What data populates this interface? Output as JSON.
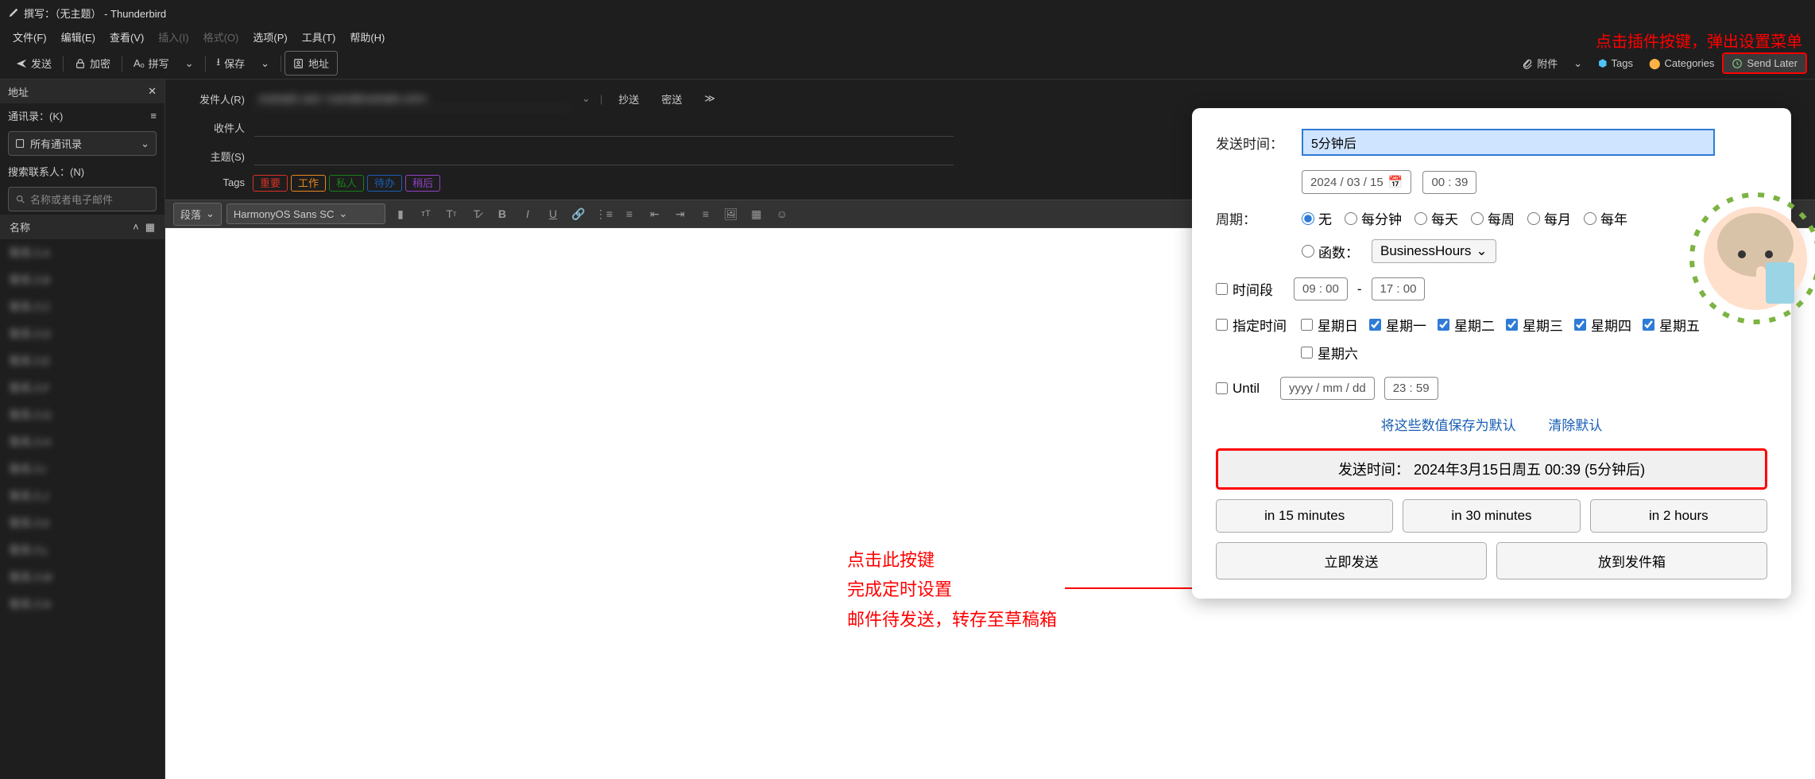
{
  "titlebar": {
    "text": "撰写：（无主题） - Thunderbird"
  },
  "menubar": {
    "items": [
      "文件(F)",
      "编辑(E)",
      "查看(V)",
      "插入(I)",
      "格式(O)",
      "选项(P)",
      "工具(T)",
      "帮助(H)"
    ],
    "disabled": [
      3,
      4
    ]
  },
  "toolbar": {
    "send": "发送",
    "encrypt": "加密",
    "spell": "拼写",
    "save": "保存",
    "address": "地址",
    "attach": "附件",
    "tags": "Tags",
    "categories": "Categories",
    "send_later": "Send Later"
  },
  "annotations": {
    "top": "点击插件按键，弹出设置菜单",
    "mid1": "点击此按键",
    "mid2": "完成定时设置",
    "mid3": "邮件待发送，转存至草稿箱"
  },
  "sidebar": {
    "header": "地址",
    "ab_label": "通讯录：(K)",
    "ab_selected": "所有通讯录",
    "search_label": "搜索联系人：(N)",
    "search_placeholder": "名称或者电子邮件",
    "name_header": "名称",
    "contacts": [
      "联系人A",
      "联系人B",
      "联系人C",
      "联系人D",
      "联系人E",
      "联系人F",
      "联系人G",
      "联系人H",
      "联系人I",
      "联系人J",
      "联系人K",
      "联系人L",
      "联系人M",
      "联系人N"
    ]
  },
  "compose": {
    "from_label": "发件人(R)",
    "from_value": "example user <user@example.com>",
    "cc": "抄送",
    "bcc": "密送",
    "to_label": "收件人",
    "subject_label": "主题(S)",
    "tags_label": "Tags",
    "tags": [
      {
        "text": "重要",
        "color": "#d93025"
      },
      {
        "text": "工作",
        "color": "#e8871e"
      },
      {
        "text": "私人",
        "color": "#1a7f1a"
      },
      {
        "text": "待办",
        "color": "#1a5fb4"
      },
      {
        "text": "稍后",
        "color": "#9141c4"
      }
    ],
    "format_para": "段落",
    "format_font": "HarmonyOS Sans SC"
  },
  "popup": {
    "send_at_label": "发送时间：",
    "send_at_value": "5分钟后",
    "date": "2024 / 03 / 15",
    "time": "00 : 39",
    "cycle_label": "周期：",
    "cycle_options": [
      "无",
      "每分钟",
      "每天",
      "每周",
      "每月",
      "每年"
    ],
    "cycle_selected": 0,
    "func_label": "函数：",
    "func_value": "BusinessHours",
    "range_label": "时间段",
    "range_from": "09 : 00",
    "range_to": "17 : 00",
    "days_label": "指定时间",
    "days": [
      {
        "label": "星期日",
        "checked": false
      },
      {
        "label": "星期一",
        "checked": true
      },
      {
        "label": "星期二",
        "checked": true
      },
      {
        "label": "星期三",
        "checked": true
      },
      {
        "label": "星期四",
        "checked": true
      },
      {
        "label": "星期五",
        "checked": true
      },
      {
        "label": "星期六",
        "checked": false
      }
    ],
    "until_label": "Until",
    "until_date": "yyyy / mm / dd",
    "until_time": "23 : 59",
    "save_defaults": "将这些数值保存为默认",
    "clear_defaults": "清除默认",
    "send_summary": "发送时间： 2024年3月15日周五 00:39 (5分钟后)",
    "quick": [
      "in 15 minutes",
      "in 30 minutes",
      "in 2 hours"
    ],
    "send_now": "立即发送",
    "outbox": "放到发件箱"
  }
}
